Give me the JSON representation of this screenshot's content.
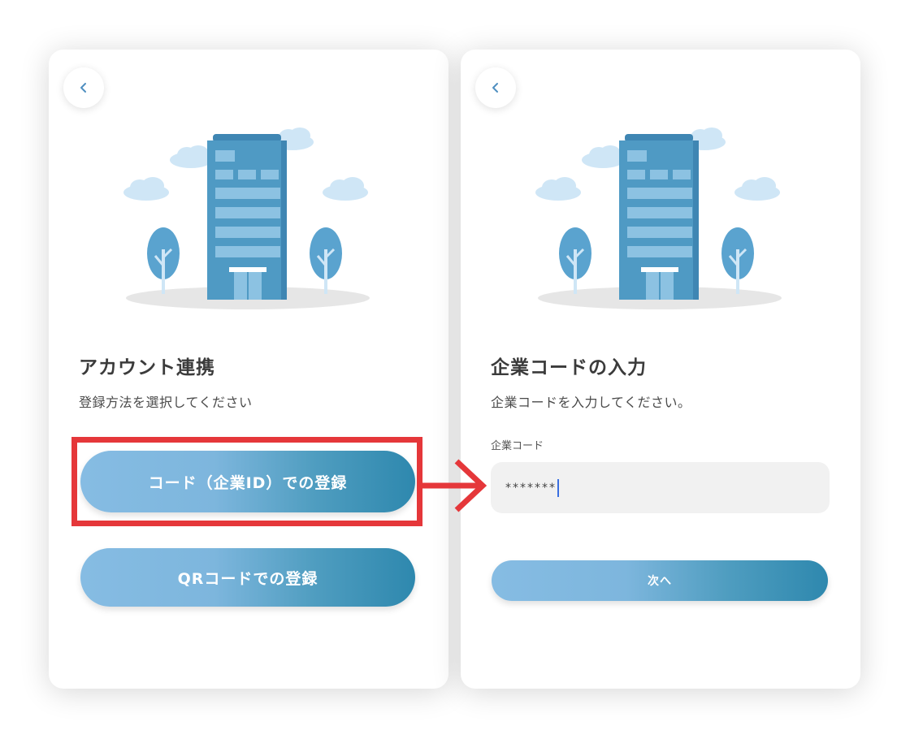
{
  "left_screen": {
    "title": "アカウント連携",
    "subtitle": "登録方法を選択してください",
    "buttons": {
      "code_register": "コード（企業ID）での登録",
      "qr_register": "QRコードでの登録"
    }
  },
  "right_screen": {
    "title": "企業コードの入力",
    "subtitle": "企業コードを入力してください。",
    "field_label": "企業コード",
    "field_value": "*******",
    "next_button": "次へ"
  },
  "icons": {
    "back": "chevron-left-icon",
    "arrow": "arrow-right-icon",
    "illustration": "office-building-illustration"
  },
  "colors": {
    "highlight": "#e5373a",
    "button_gradient_start": "#86bce3",
    "button_gradient_end": "#2e88ae",
    "building": "#4f9ac4"
  }
}
